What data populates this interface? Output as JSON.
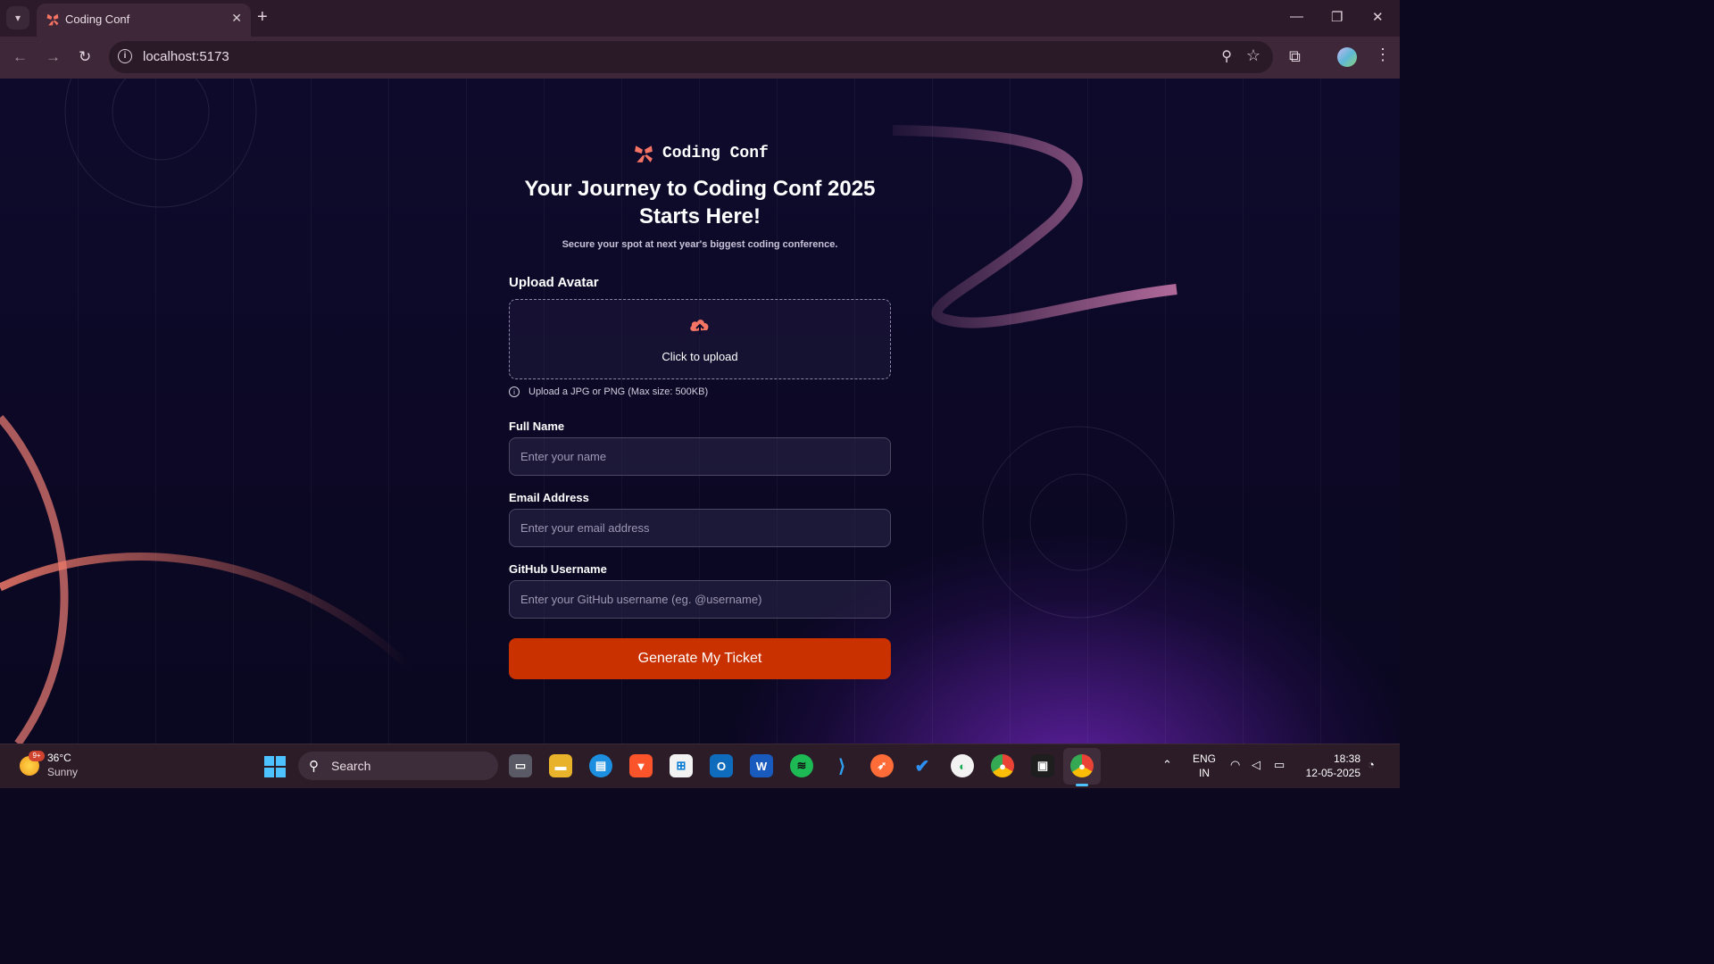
{
  "browser": {
    "tab_title": "Coding Conf",
    "url": "localhost:5173"
  },
  "page": {
    "logo_text": "Coding Conf",
    "headline_line1": "Your Journey to Coding Conf 2025",
    "headline_line2": "Starts Here!",
    "subheadline": "Secure your spot at next year's biggest coding conference.",
    "upload": {
      "label": "Upload Avatar",
      "cta": "Click to upload",
      "hint": "Upload a JPG or PNG (Max size: 500KB)"
    },
    "fields": [
      {
        "label": "Full Name",
        "placeholder": "Enter your name"
      },
      {
        "label": "Email Address",
        "placeholder": "Enter your email address"
      },
      {
        "label": "GitHub Username",
        "placeholder": "Enter your GitHub username (eg. @username)"
      }
    ],
    "submit_label": "Generate My Ticket",
    "colors": {
      "accent": "#c93200",
      "logo": "#f57463",
      "background": "#0e0a2c"
    }
  },
  "taskbar": {
    "weather_badge": "9+",
    "temperature": "36°C",
    "condition": "Sunny",
    "search_label": "Search",
    "apps": [
      "task-view-icon",
      "file-explorer-icon",
      "docker-icon",
      "brave-icon",
      "microsoft-store-icon",
      "outlook-icon",
      "word-icon",
      "spotify-icon",
      "vscode-icon",
      "postman-icon",
      "todo-icon",
      "mongodb-compass-icon",
      "chrome-icon",
      "terminal-icon",
      "chrome-profile-icon"
    ],
    "language": "ENG",
    "region": "IN",
    "time": "18:38",
    "date": "12-05-2025"
  }
}
